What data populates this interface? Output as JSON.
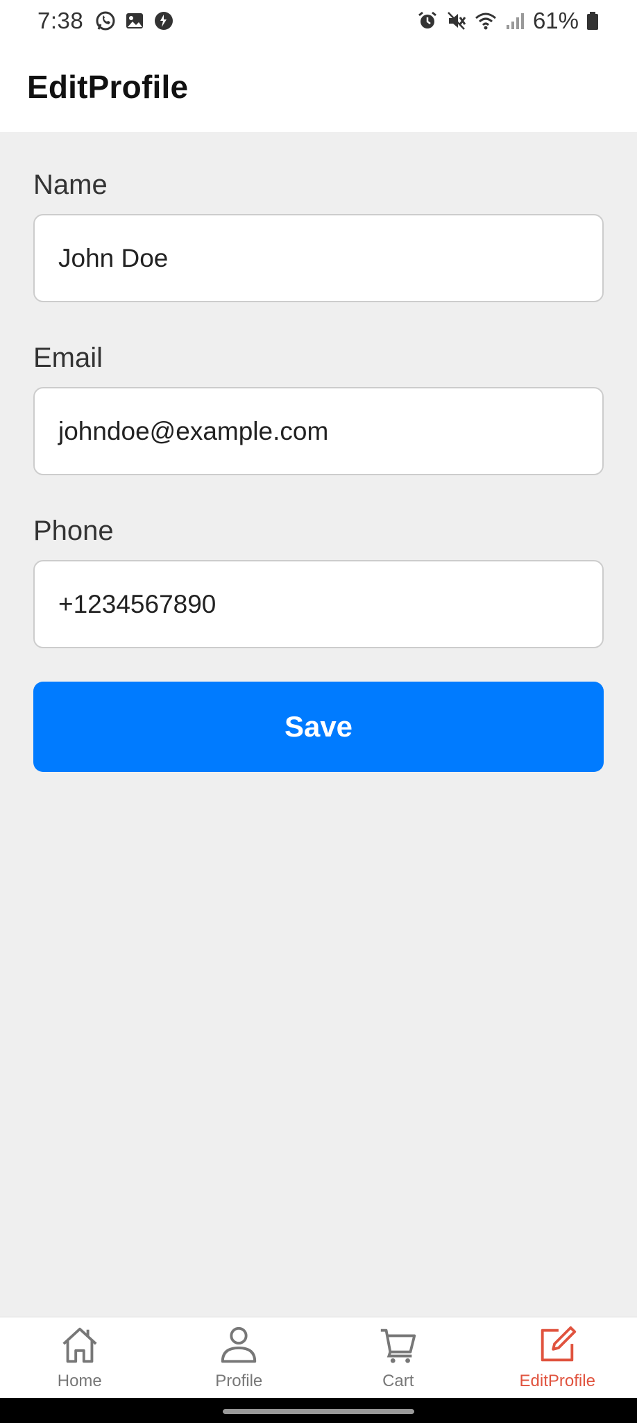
{
  "status_bar": {
    "time": "7:38",
    "battery": "61%",
    "left_icons": [
      "whatsapp-icon",
      "gallery-icon",
      "vpn-icon"
    ],
    "right_icons": [
      "alarm-icon",
      "mute-icon",
      "wifi-icon",
      "signal-icon",
      "battery-icon"
    ]
  },
  "header": {
    "title": "EditProfile"
  },
  "form": {
    "name": {
      "label": "Name",
      "value": "John Doe"
    },
    "email": {
      "label": "Email",
      "value": "johndoe@example.com"
    },
    "phone": {
      "label": "Phone",
      "value": "+1234567890"
    },
    "save_label": "Save"
  },
  "bottom_nav": {
    "items": [
      {
        "label": "Home",
        "icon": "home-icon",
        "active": false
      },
      {
        "label": "Profile",
        "icon": "person-icon",
        "active": false
      },
      {
        "label": "Cart",
        "icon": "cart-icon",
        "active": false
      },
      {
        "label": "EditProfile",
        "icon": "edit-icon",
        "active": true
      }
    ]
  },
  "colors": {
    "accent": "#007bff",
    "active_tab": "#e0533e",
    "inactive_tab": "#777777",
    "background": "#efefef"
  }
}
